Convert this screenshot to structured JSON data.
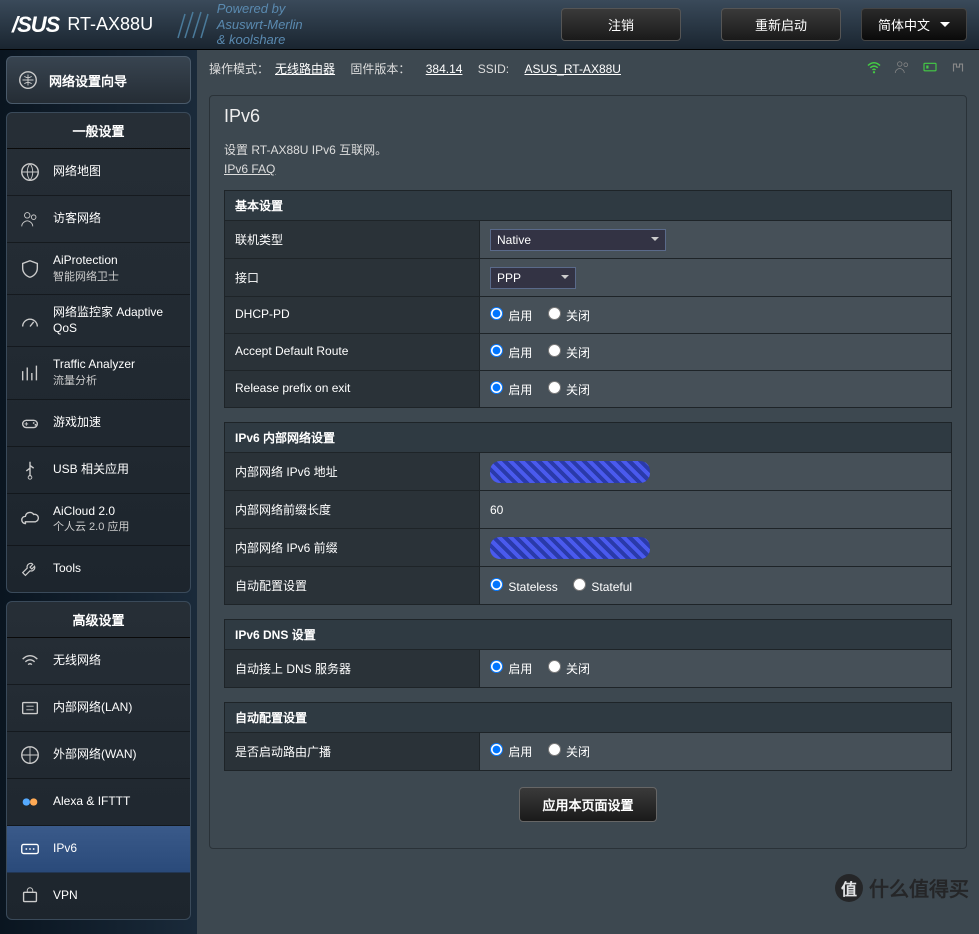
{
  "header": {
    "brand": "/SUS",
    "model": "RT-AX88U",
    "powered_l1": "Powered by",
    "powered_l2": "Asuswrt-Merlin",
    "powered_l3": "& koolshare",
    "logout": "注销",
    "reboot": "重新启动",
    "language": "简体中文"
  },
  "status": {
    "mode_label": "操作模式：",
    "mode_value": "无线路由器",
    "fw_label": "固件版本：",
    "fw_value": "384.14",
    "ssid_label": "SSID:",
    "ssid_value": "ASUS_RT-AX88U"
  },
  "sidebar": {
    "wizard": "网络设置向导",
    "general_hdr": "一般设置",
    "advanced_hdr": "高级设置",
    "general": [
      {
        "label": "网络地图",
        "sub": ""
      },
      {
        "label": "访客网络",
        "sub": ""
      },
      {
        "label": "AiProtection",
        "sub": "智能网络卫士"
      },
      {
        "label": "网络监控家 Adaptive QoS",
        "sub": ""
      },
      {
        "label": "Traffic Analyzer",
        "sub": "流量分析"
      },
      {
        "label": "游戏加速",
        "sub": ""
      },
      {
        "label": "USB 相关应用",
        "sub": ""
      },
      {
        "label": "AiCloud 2.0",
        "sub": "个人云 2.0 应用"
      },
      {
        "label": "Tools",
        "sub": ""
      }
    ],
    "advanced": [
      {
        "label": "无线网络"
      },
      {
        "label": "内部网络(LAN)"
      },
      {
        "label": "外部网络(WAN)"
      },
      {
        "label": "Alexa & IFTTT"
      },
      {
        "label": "IPv6"
      },
      {
        "label": "VPN"
      }
    ]
  },
  "page": {
    "title": "IPv6",
    "desc": "设置 RT-AX88U IPv6 互联网。",
    "faq": "IPv6 FAQ"
  },
  "sections": {
    "basic": "基本设置",
    "lan": "IPv6 内部网络设置",
    "dns": "IPv6 DNS 设置",
    "auto": "自动配置设置"
  },
  "fields": {
    "conn_type": {
      "label": "联机类型",
      "value": "Native"
    },
    "interface": {
      "label": "接口",
      "value": "PPP"
    },
    "dhcp_pd": {
      "label": "DHCP-PD"
    },
    "default_route": {
      "label": "Accept Default Route"
    },
    "release_prefix": {
      "label": "Release prefix on exit"
    },
    "lan_addr": {
      "label": "内部网络 IPv6 地址"
    },
    "prefix_len": {
      "label": "内部网络前缀长度",
      "value": "60"
    },
    "lan_prefix": {
      "label": "内部网络 IPv6 前缀"
    },
    "autoconfig": {
      "label": "自动配置设置"
    },
    "auto_dns": {
      "label": "自动接上 DNS 服务器"
    },
    "router_adv": {
      "label": "是否启动路由广播"
    }
  },
  "radio": {
    "enable": "启用",
    "disable": "关闭",
    "stateless": "Stateless",
    "stateful": "Stateful"
  },
  "apply": "应用本页面设置",
  "watermark": "什么值得买"
}
